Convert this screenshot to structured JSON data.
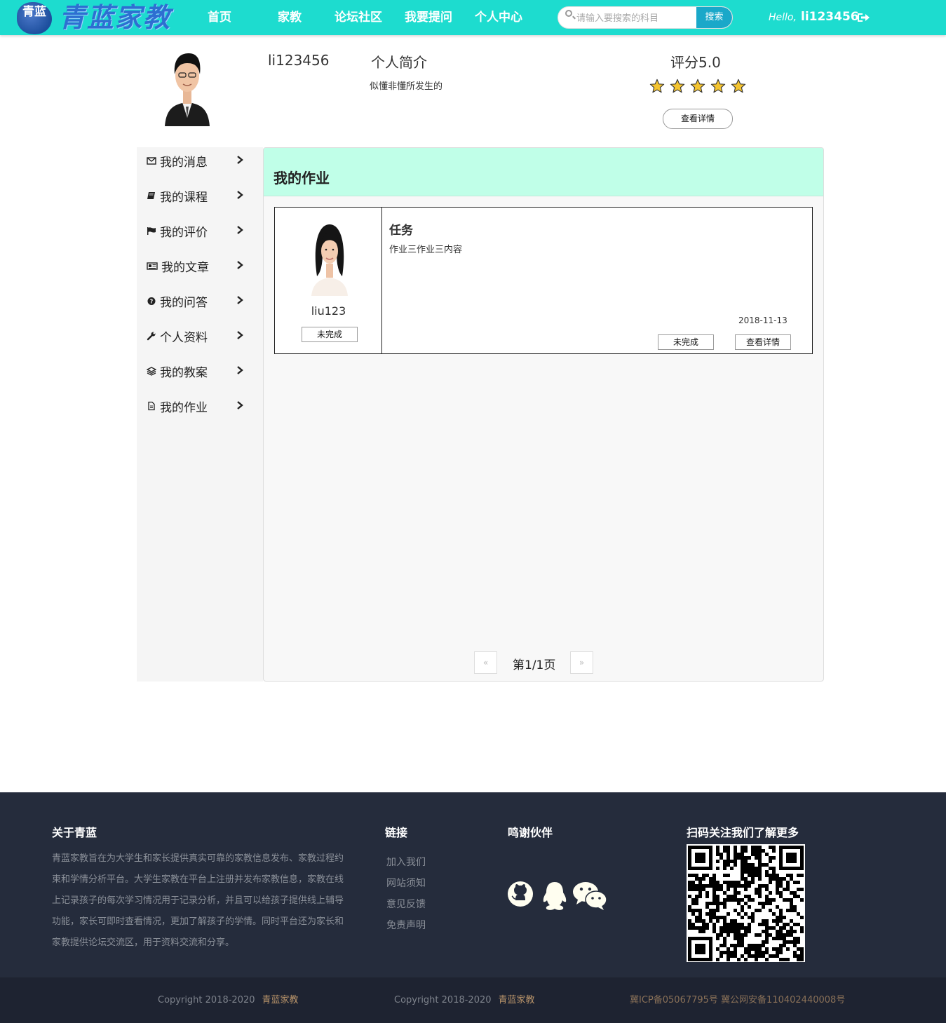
{
  "navbar": {
    "logo_seal": "青蓝",
    "logo_text": "青蓝家教",
    "links": [
      "首页",
      "家教",
      "论坛社区",
      "我要提问",
      "个人中心"
    ],
    "search_placeholder": "请输入要搜索的科目",
    "search_button": "搜索",
    "hello": "Hello,",
    "username": "li123456"
  },
  "profile": {
    "name": "li123456",
    "bio_title": "个人简介",
    "bio_text": "似懂非懂所发生的",
    "score_label": "评分5.0",
    "rating": 5,
    "detail_button": "查看详情"
  },
  "sidebar": {
    "items": [
      {
        "label": "我的消息",
        "icon": "envelope-icon"
      },
      {
        "label": "我的课程",
        "icon": "book-icon"
      },
      {
        "label": "我的评价",
        "icon": "flag-icon"
      },
      {
        "label": "我的文章",
        "icon": "newspaper-icon"
      },
      {
        "label": "我的问答",
        "icon": "question-circle-icon"
      },
      {
        "label": "个人资料",
        "icon": "wrench-icon"
      },
      {
        "label": "我的教案",
        "icon": "layers-icon"
      },
      {
        "label": "我的作业",
        "icon": "file-icon"
      }
    ]
  },
  "main": {
    "title": "我的作业",
    "homework": {
      "teacher_name": "liu123",
      "left_status": "未完成",
      "task_title": "任务",
      "task_content": "作业三作业三内容",
      "date": "2018-11-13",
      "status_button": "未完成",
      "detail_button": "查看详情"
    },
    "pagination": {
      "prev": "«",
      "text": "第1/1页",
      "next": "»"
    }
  },
  "footer": {
    "about_title": "关于青蓝",
    "about_text": "青蓝家教旨在为大学生和家长提供真实可靠的家教信息发布、家教过程约束和学情分析平台。大学生家教在平台上注册并发布家教信息，家教在线上记录孩子的每次学习情况用于记录分析，并且可以给孩子提供线上辅导功能，家长可即时查看情况，更加了解孩子的学情。同时平台还为家长和家教提供论坛交流区，用于资料交流和分享。",
    "links_title": "链接",
    "links": [
      "加入我们",
      "网站须知",
      "意见反馈",
      "免责声明"
    ],
    "partners_title": "鸣谢伙伴",
    "partner_icons": [
      "github-icon",
      "qq-icon",
      "wechat-icon"
    ],
    "qr_title": "扫码关注我们了解更多",
    "copyright_1": "Copyright 2018-2020",
    "brand_1": "青蓝家教",
    "copyright_2": "Copyright 2018-2020",
    "brand_2": "青蓝家教",
    "icp": "冀ICP备05067795号 冀公网安备110402440008号"
  },
  "colors": {
    "navbar": "#1ddccf",
    "panel_header": "#c0ffe8",
    "footer": "#252c3c",
    "search_button": "#1aa8c9"
  }
}
